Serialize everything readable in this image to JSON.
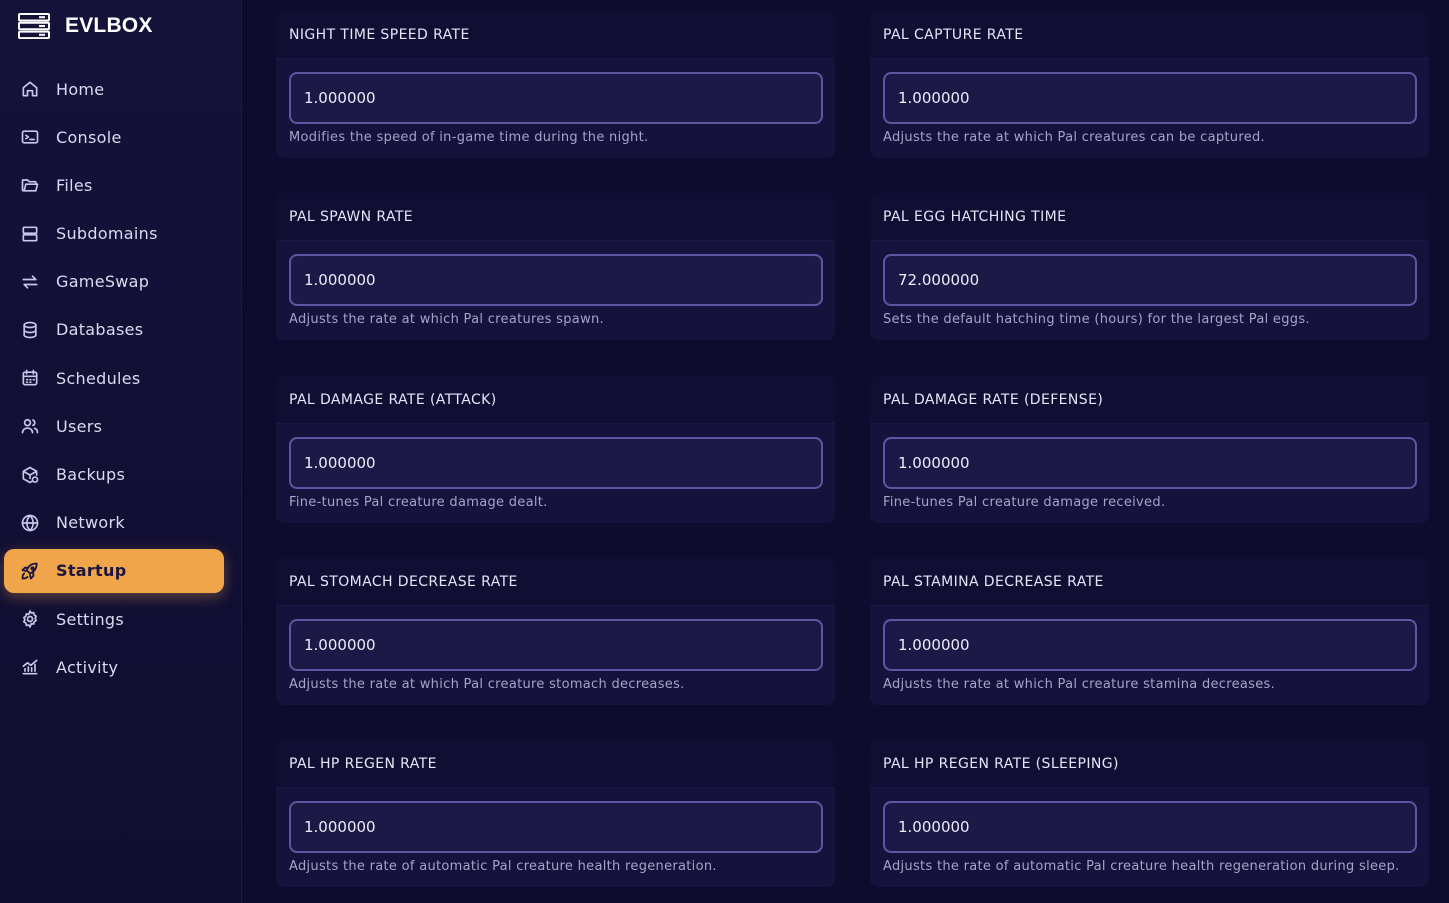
{
  "brand": {
    "name": "EVLBOX"
  },
  "colors": {
    "accent": "#f0a54a",
    "background": "#0d0b2e",
    "card": "#15123c",
    "input_border": "#5b57a3"
  },
  "sidebar": {
    "items": [
      {
        "label": "Home",
        "icon": "home-icon"
      },
      {
        "label": "Console",
        "icon": "terminal-icon"
      },
      {
        "label": "Files",
        "icon": "folder-icon"
      },
      {
        "label": "Subdomains",
        "icon": "server-icon"
      },
      {
        "label": "GameSwap",
        "icon": "swap-icon"
      },
      {
        "label": "Databases",
        "icon": "database-icon"
      },
      {
        "label": "Schedules",
        "icon": "calendar-icon"
      },
      {
        "label": "Users",
        "icon": "users-icon"
      },
      {
        "label": "Backups",
        "icon": "backup-icon"
      },
      {
        "label": "Network",
        "icon": "globe-icon"
      },
      {
        "label": "Startup",
        "icon": "rocket-icon",
        "active": true
      },
      {
        "label": "Settings",
        "icon": "gear-icon"
      },
      {
        "label": "Activity",
        "icon": "activity-icon"
      }
    ]
  },
  "variables": [
    {
      "title": "NIGHT TIME SPEED RATE",
      "value": "1.000000",
      "description": "Modifies the speed of in-game time during the night."
    },
    {
      "title": "PAL CAPTURE RATE",
      "value": "1.000000",
      "description": "Adjusts the rate at which Pal creatures can be captured."
    },
    {
      "title": "PAL SPAWN RATE",
      "value": "1.000000",
      "description": "Adjusts the rate at which Pal creatures spawn."
    },
    {
      "title": "PAL EGG HATCHING TIME",
      "value": "72.000000",
      "description": "Sets the default hatching time (hours) for the largest Pal eggs."
    },
    {
      "title": "PAL DAMAGE RATE (ATTACK)",
      "value": "1.000000",
      "description": "Fine-tunes Pal creature damage dealt."
    },
    {
      "title": "PAL DAMAGE RATE (DEFENSE)",
      "value": "1.000000",
      "description": "Fine-tunes Pal creature damage received."
    },
    {
      "title": "PAL STOMACH DECREASE RATE",
      "value": "1.000000",
      "description": "Adjusts the rate at which Pal creature stomach decreases."
    },
    {
      "title": "PAL STAMINA DECREASE RATE",
      "value": "1.000000",
      "description": "Adjusts the rate at which Pal creature stamina decreases."
    },
    {
      "title": "PAL HP REGEN RATE",
      "value": "1.000000",
      "description": "Adjusts the rate of automatic Pal creature health regeneration."
    },
    {
      "title": "PAL HP REGEN RATE (SLEEPING)",
      "value": "1.000000",
      "description": "Adjusts the rate of automatic Pal creature health regeneration during sleep."
    }
  ]
}
